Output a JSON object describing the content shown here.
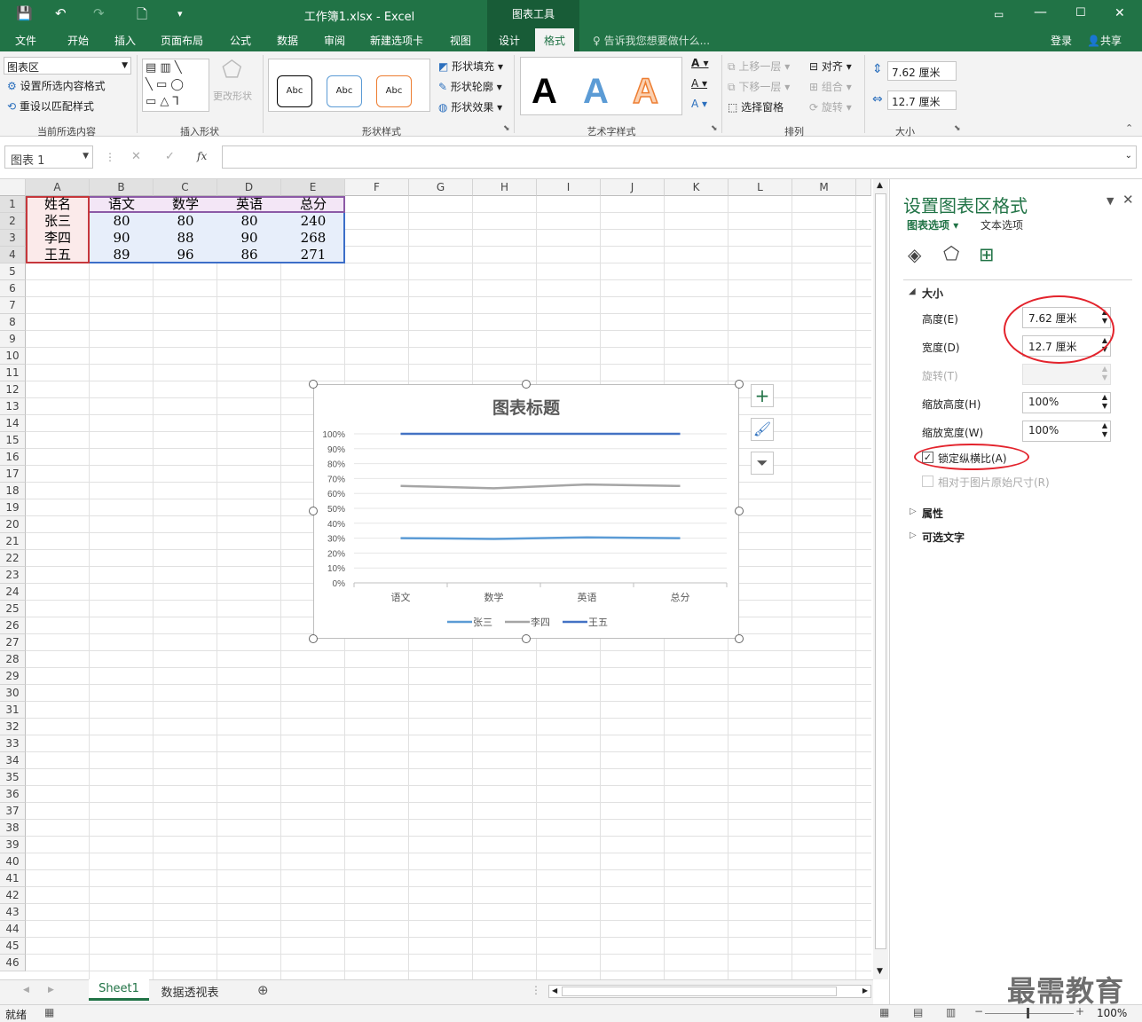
{
  "window": {
    "title": "工作簿1.xlsx - Excel",
    "context_tool": "图表工具",
    "login": "登录",
    "share": "共享"
  },
  "tabs": [
    "文件",
    "开始",
    "插入",
    "页面布局",
    "公式",
    "数据",
    "审阅",
    "新建选项卡",
    "视图",
    "设计",
    "格式"
  ],
  "active_tab": "格式",
  "tell_me": "告诉我您想要做什么...",
  "ribbon": {
    "current_selection": {
      "dropdown": "图表区",
      "format_selection": "设置所选内容格式",
      "reset_style": "重设以匹配样式",
      "group": "当前所选内容"
    },
    "insert_shapes": {
      "change_shape": "更改形状",
      "group": "插入形状"
    },
    "shape_styles": {
      "samples": [
        "Abc",
        "Abc",
        "Abc"
      ],
      "fill": "形状填充",
      "outline": "形状轮廓",
      "effects": "形状效果",
      "group": "形状样式"
    },
    "wordart": {
      "samples": [
        "A",
        "A",
        "A"
      ],
      "group": "艺术字样式"
    },
    "arrange": {
      "bring_forward": "上移一层",
      "send_backward": "下移一层",
      "selection_pane": "选择窗格",
      "align": "对齐",
      "group_btn": "组合",
      "rotate": "旋转",
      "group": "排列"
    },
    "size": {
      "height": "7.62 厘米",
      "width": "12.7 厘米",
      "group": "大小"
    }
  },
  "formula_bar": {
    "name_box": "图表 1",
    "fx": "fx",
    "cancel": "✕",
    "enter": "✓"
  },
  "columns": [
    "A",
    "B",
    "C",
    "D",
    "E",
    "F",
    "G",
    "H",
    "I",
    "J",
    "K",
    "L",
    "M"
  ],
  "rows": [
    "1",
    "2",
    "3",
    "4",
    "5",
    "6",
    "7",
    "8",
    "9",
    "10",
    "11",
    "12",
    "13",
    "14",
    "15",
    "16",
    "17",
    "18",
    "19",
    "20",
    "21",
    "22",
    "23",
    "24",
    "25",
    "26",
    "27",
    "28",
    "29",
    "30",
    "31",
    "32",
    "33",
    "34",
    "35",
    "36",
    "37",
    "38",
    "39",
    "40",
    "41",
    "42",
    "43",
    "44",
    "45",
    "46"
  ],
  "table": {
    "header": [
      "姓名",
      "语文",
      "数学",
      "英语",
      "总分"
    ],
    "rows": [
      [
        "张三",
        "80",
        "80",
        "80",
        "240"
      ],
      [
        "李四",
        "90",
        "88",
        "90",
        "268"
      ],
      [
        "王五",
        "89",
        "96",
        "86",
        "271"
      ]
    ]
  },
  "chart_data": {
    "type": "line",
    "title": "图表标题",
    "categories": [
      "语文",
      "数学",
      "英语",
      "总分"
    ],
    "y_ticks": [
      "0%",
      "10%",
      "20%",
      "30%",
      "40%",
      "50%",
      "60%",
      "70%",
      "80%",
      "90%",
      "100%"
    ],
    "ylim": [
      0,
      1
    ],
    "grid": true,
    "legend_position": "bottom",
    "series": [
      {
        "name": "张三",
        "color": "#5b9bd5",
        "values": [
          0.3,
          0.295,
          0.305,
          0.3
        ]
      },
      {
        "name": "李四",
        "color": "#a5a5a5",
        "values": [
          0.65,
          0.635,
          0.66,
          0.65
        ]
      },
      {
        "name": "王五",
        "color": "#4472c4",
        "values": [
          1,
          1,
          1,
          1
        ]
      }
    ]
  },
  "chart_buttons": [
    "+",
    "brush",
    "filter"
  ],
  "pane": {
    "title": "设置图表区格式",
    "tab_chart": "图表选项",
    "tab_text": "文本选项",
    "section_size": "大小",
    "height_label": "高度(E)",
    "height_value": "7.62 厘米",
    "width_label": "宽度(D)",
    "width_value": "12.7 厘米",
    "rotate_label": "旋转(T)",
    "scale_h_label": "缩放高度(H)",
    "scale_h_value": "100%",
    "scale_w_label": "缩放宽度(W)",
    "scale_w_value": "100%",
    "lock_ratio": "锁定纵横比(A)",
    "lock_checked": true,
    "relative": "相对于图片原始尺寸(R)",
    "properties": "属性",
    "alt_text": "可选文字"
  },
  "sheets": [
    "Sheet1",
    "数据透视表"
  ],
  "active_sheet": "Sheet1",
  "status": {
    "ready": "就绪",
    "zoom": "100%"
  },
  "watermark": "最需教育"
}
